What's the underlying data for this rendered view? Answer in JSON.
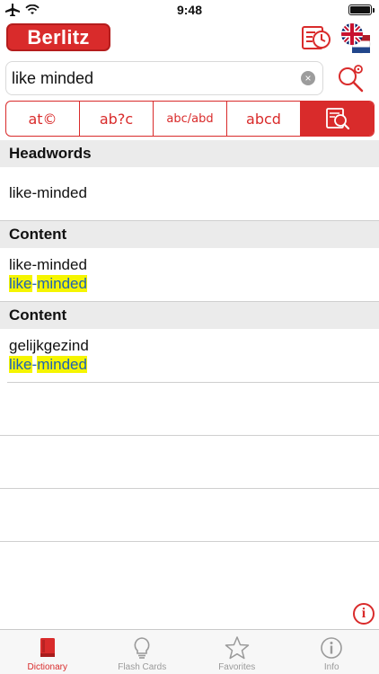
{
  "status_bar": {
    "time": "9:48"
  },
  "header": {
    "logo_text": "Berlitz"
  },
  "search": {
    "value": "like minded",
    "clear_glyph": "×"
  },
  "tools": [
    {
      "name": "spell",
      "label": "at©"
    },
    {
      "name": "wildcard",
      "label": "ab?c"
    },
    {
      "name": "fuzzy",
      "label": "abc/abd"
    },
    {
      "name": "anagram",
      "label": "abcd"
    },
    {
      "name": "fulltext",
      "label": ""
    }
  ],
  "sections": [
    {
      "title": "Headwords",
      "rows": [
        {
          "term": "like-minded"
        }
      ]
    },
    {
      "title": "Content",
      "rows": [
        {
          "term": "like-minded",
          "match_a": "like",
          "sep": "-",
          "match_b": "minded"
        }
      ]
    },
    {
      "title": "Content",
      "rows": [
        {
          "term": "gelijkgezind",
          "match_a": "like",
          "sep": "-",
          "match_b": "minded"
        }
      ]
    }
  ],
  "info_label": "i",
  "tabbar": {
    "tabs": [
      {
        "label": "Dictionary",
        "icon": "book-icon",
        "active": true
      },
      {
        "label": "Flash Cards",
        "icon": "lightbulb-icon",
        "active": false
      },
      {
        "label": "Favorites",
        "icon": "star-icon",
        "active": false
      },
      {
        "label": "Info",
        "icon": "info-icon",
        "active": false
      }
    ]
  },
  "colors": {
    "accent": "#d92b2b",
    "highlight": "#f5f500",
    "link": "#1e62b5"
  }
}
